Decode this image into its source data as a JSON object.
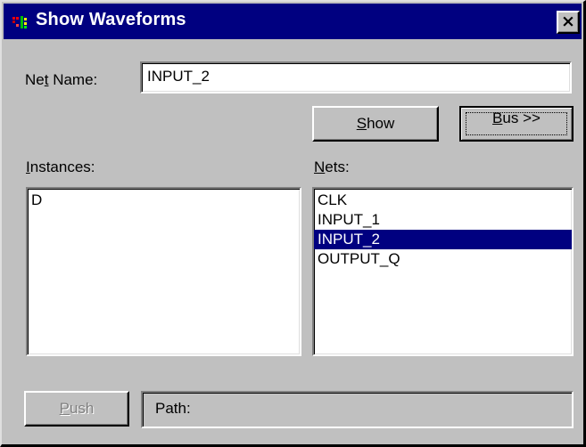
{
  "window": {
    "title": "Show Waveforms",
    "title_icon": "waveform-app-icon",
    "close_glyph": "×"
  },
  "net_name": {
    "label_pre": "Ne",
    "label_accel": "t",
    "label_post": " Name:",
    "value": "INPUT_2"
  },
  "buttons": {
    "show": {
      "accel": "S",
      "rest": "how"
    },
    "bus": {
      "accel": "B",
      "rest": "us >>"
    },
    "push": {
      "accel": "P",
      "rest": "ush",
      "enabled": false
    }
  },
  "instances": {
    "label_accel": "I",
    "label_rest": "nstances:",
    "items": [
      "D"
    ]
  },
  "nets": {
    "label_accel": "N",
    "label_rest": "ets:",
    "items": [
      "CLK",
      "INPUT_1",
      "INPUT_2",
      "OUTPUT_Q"
    ],
    "selected_index": 2
  },
  "path": {
    "label": "Path:"
  },
  "colors": {
    "face": "#c0c0c0",
    "titlebar": "#000080",
    "selection": "#000080",
    "disabled_text": "#808080"
  }
}
